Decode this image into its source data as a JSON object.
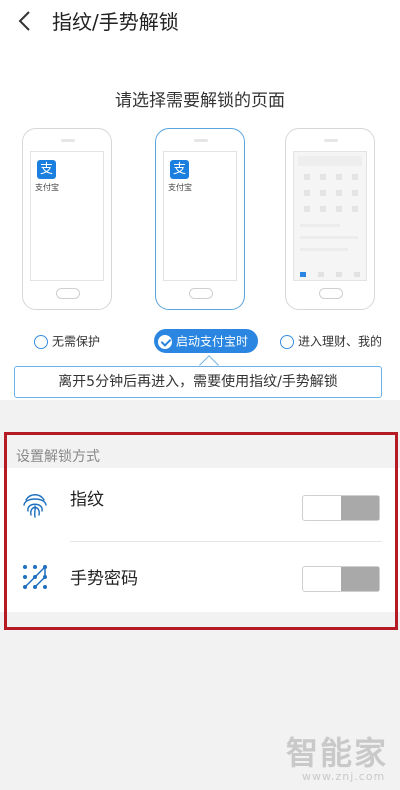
{
  "header": {
    "title": "指纹/手势解锁"
  },
  "page": {
    "prompt": "请选择需要解锁的页面",
    "phones": [
      {
        "app_label": "支付宝",
        "app_icon_char": "支"
      },
      {
        "app_label": "支付宝",
        "app_icon_char": "支"
      }
    ],
    "options": [
      {
        "label": "无需保护",
        "selected": false
      },
      {
        "label": "启动支付宝时",
        "selected": true
      },
      {
        "label": "进入理财、我的",
        "selected": false
      }
    ],
    "note": "离开5分钟后再进入，需要使用指纹/手势解锁"
  },
  "settings": {
    "section_title": "设置解锁方式",
    "items": [
      {
        "label": "指纹",
        "icon": "fingerprint-icon",
        "enabled": false
      },
      {
        "label": "手势密码",
        "icon": "gesture-pattern-icon",
        "enabled": false
      }
    ]
  },
  "watermark": {
    "text": "智能家",
    "sub": "www.znj.com"
  },
  "colors": {
    "accent": "#2a86e0",
    "highlight": "#b51b25",
    "alipay": "#1b7fe0"
  }
}
